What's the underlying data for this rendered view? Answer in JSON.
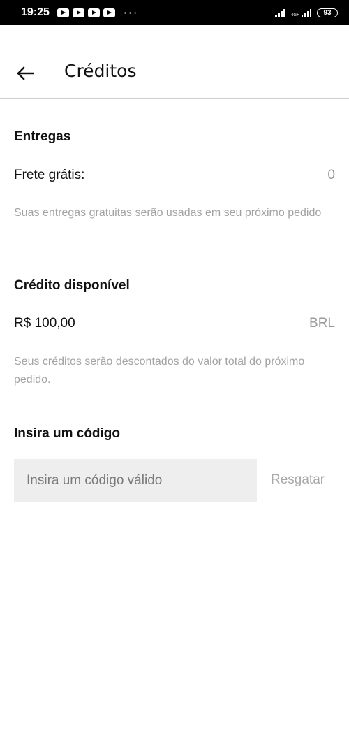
{
  "status_bar": {
    "time": "19:25",
    "network": "4G+",
    "battery": "93"
  },
  "header": {
    "title": "Créditos"
  },
  "deliveries": {
    "title": "Entregas",
    "free_shipping_label": "Frete grátis:",
    "free_shipping_value": "0",
    "note": "Suas entregas gratuitas serão usadas em seu próximo pedido"
  },
  "credit": {
    "title": "Crédito disponível",
    "amount": "R$ 100,00",
    "currency": "BRL",
    "note": "Seus créditos serão descontados do valor total do próximo pedido."
  },
  "code": {
    "title": "Insira um código",
    "input_placeholder": "Insira um código válido",
    "input_value": "",
    "redeem_label": "Resgatar"
  }
}
